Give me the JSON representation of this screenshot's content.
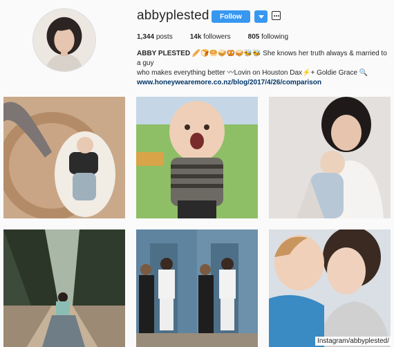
{
  "profile": {
    "username": "abbyplested",
    "follow_label": "Follow",
    "stats": [
      {
        "value": "1,344",
        "label": "posts"
      },
      {
        "value": "14k",
        "label": "followers"
      },
      {
        "value": "805",
        "label": "following"
      }
    ],
    "display_name": "ABBY PLESTED",
    "bio_line1": "🥖🍞🥯🥪🥨🥪🐝🐝 She knows her truth always & married to a guy",
    "bio_line2": "who makes everything better 〰Lovin on Houston Dax⚡+ Goldie Grace 🔍",
    "website": "www.honeywearemore.co.nz/blog/2017/4/26/comparison"
  },
  "posts": [
    {
      "subject": "baby on sheepskin rug with cat"
    },
    {
      "subject": "laughing baby held outdoors"
    },
    {
      "subject": "mother holding baby"
    },
    {
      "subject": "woman walking on tree-lined path"
    },
    {
      "subject": "two women in front of blue doors"
    },
    {
      "subject": "child kissing mother"
    }
  ],
  "caption": "Instagram/abbyplested/",
  "colors": {
    "accent": "#3897f0",
    "link": "#003569",
    "background": "#fafafa"
  }
}
